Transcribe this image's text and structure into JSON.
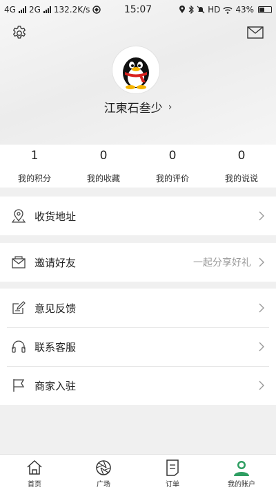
{
  "status_bar": {
    "network_1": "4G",
    "network_2": "2G",
    "speed": "132.2K/s",
    "time": "15:07",
    "hd": "HD",
    "battery": "43%"
  },
  "profile": {
    "username": "江東石叁少"
  },
  "stats": [
    {
      "value": "1",
      "label": "我的积分"
    },
    {
      "value": "0",
      "label": "我的收藏"
    },
    {
      "value": "0",
      "label": "我的评价"
    },
    {
      "value": "0",
      "label": "我的说说"
    }
  ],
  "menu": {
    "address": {
      "label": "收货地址"
    },
    "invite": {
      "label": "邀请好友",
      "extra": "一起分享好礼"
    },
    "feedback": {
      "label": "意见反馈"
    },
    "service": {
      "label": "联系客服"
    },
    "merchant": {
      "label": "商家入驻"
    }
  },
  "tabbar": [
    {
      "label": "首页",
      "icon": "home-icon"
    },
    {
      "label": "广场",
      "icon": "aperture-icon"
    },
    {
      "label": "订单",
      "icon": "order-icon"
    },
    {
      "label": "我的账户",
      "icon": "account-icon",
      "active": true
    }
  ],
  "colors": {
    "accent": "#2e9e62",
    "background": "#f0f0f0"
  }
}
